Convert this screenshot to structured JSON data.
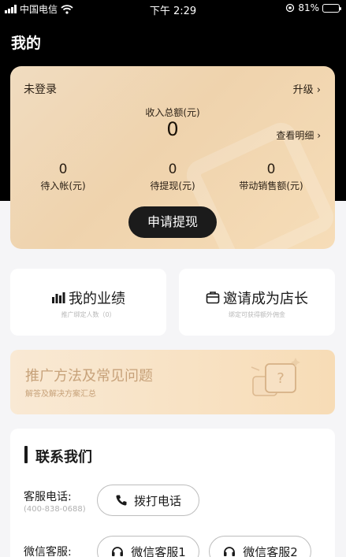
{
  "status_bar": {
    "carrier": "中国电信",
    "time": "下午 2:29",
    "battery": "81%"
  },
  "header": {
    "title": "我的"
  },
  "account_card": {
    "login_status": "未登录",
    "upgrade_link": "升级",
    "income_label": "收入总额(元)",
    "income_value": "0",
    "detail_link": "查看明细",
    "stats": [
      {
        "value": "0",
        "label": "待入帐(元)"
      },
      {
        "value": "0",
        "label": "待提现(元)"
      },
      {
        "value": "0",
        "label": "带动销售额(元)"
      }
    ],
    "withdraw_button": "申请提现"
  },
  "tiles": [
    {
      "title": "我的业绩",
      "subtitle": "推广绑定人数（0）",
      "icon": "chart-bars-icon"
    },
    {
      "title": "邀请成为店长",
      "subtitle": "绑定可获得额外佣金",
      "icon": "invite-box-icon"
    }
  ],
  "banner": {
    "title": "推广方法及常见问题",
    "subtitle": "解答及解决方案汇总",
    "icon": "question-bubble-icon"
  },
  "contact": {
    "heading": "联系我们",
    "phone_label": "客服电话:",
    "phone_number": "(400-838-0688)",
    "call_button": "拨打电话",
    "wechat_label": "微信客服:",
    "wechat_buttons": [
      "微信客服1",
      "微信客服2"
    ]
  }
}
